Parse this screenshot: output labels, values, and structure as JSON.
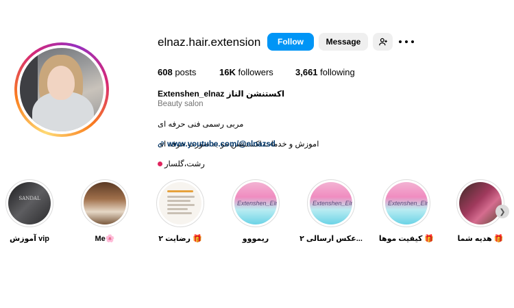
{
  "profile": {
    "username": "elnaz.hair.extension",
    "follow_label": "Follow",
    "message_label": "Message",
    "add_user_icon": "add-user-icon",
    "more_icon": "more-icon",
    "posts_count": "608",
    "posts_label": " posts",
    "followers_count": "16K",
    "followers_label": " followers",
    "following_count": "3,661",
    "following_label": " following",
    "full_name": "Extenshen_elnaz اکستنشن الناز",
    "category": "Beauty salon",
    "bio_line1": "مربی رسمی فنی حرفه ای",
    "bio_line2": "اموزش و خدمات اکستنشن مو به صورت حرفه ای",
    "bio_line3": "رشت،گلسار",
    "link_text": "www.youtube.com/@elnazsd",
    "link_icon": "link-icon"
  },
  "highlights": [
    {
      "label": "آموزش vip",
      "image": "vip"
    },
    {
      "label": "Me🌸",
      "image": "me"
    },
    {
      "label": "رضایت ۲ 🎁",
      "image": "doc"
    },
    {
      "label": "ریمووو",
      "image": "pink",
      "overlay": "Extenshen_Elnaz"
    },
    {
      "label": "عکس ارسالی ۲...",
      "image": "pink",
      "overlay": "Extenshen_Elnaz"
    },
    {
      "label": "کیفیت موها 🎁",
      "image": "pink",
      "overlay": "Extenshen_Elnaz"
    },
    {
      "label": "هدیه شما 🎁",
      "image": "gift"
    }
  ],
  "colors": {
    "primary": "#0095f6",
    "link": "#00376b",
    "secondary_text": "#737373"
  }
}
